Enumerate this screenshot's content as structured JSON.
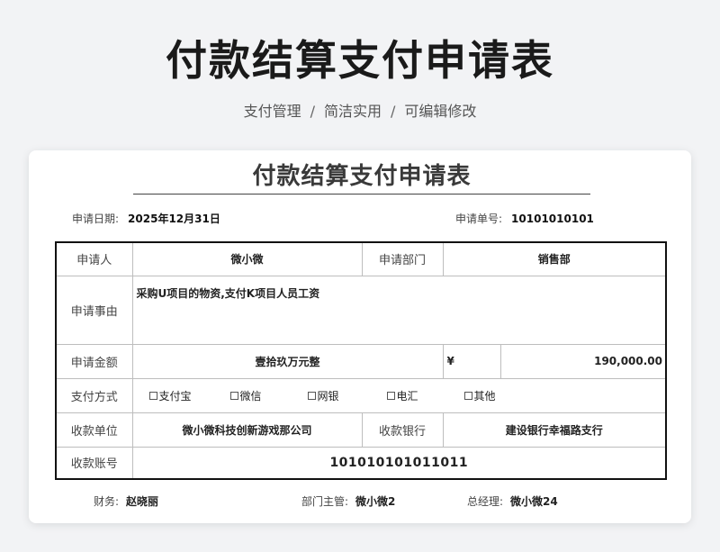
{
  "header": {
    "title": "付款结算支付申请表",
    "subtitle_parts": [
      "支付管理",
      "简洁实用",
      "可编辑修改"
    ],
    "separator": "/"
  },
  "form": {
    "title": "付款结算支付申请表",
    "date_label": "申请日期:",
    "date_value": "2025年12月31日",
    "no_label": "申请单号:",
    "no_value": "10101010101",
    "applicant_label": "申请人",
    "applicant_value": "微小微",
    "dept_label": "申请部门",
    "dept_value": "销售部",
    "reason_label": "申请事由",
    "reason_value": "采购U项目的物资,支付K项目人员工资",
    "amount_label": "申请金额",
    "amount_words": "壹拾玖万元整",
    "currency_symbol": "¥",
    "amount_value": "190,000.00",
    "method_label": "支付方式",
    "methods": [
      "支付宝",
      "微信",
      "网银",
      "电汇",
      "其他"
    ],
    "payee_label": "收款单位",
    "payee_value": "微小微科技创新游戏那公司",
    "bank_label": "收款银行",
    "bank_value": "建设银行幸福路支行",
    "account_label": "收款账号",
    "account_value": "101010101011011"
  },
  "footer": {
    "finance_label": "财务:",
    "finance_value": "赵晓丽",
    "manager_label": "部门主管:",
    "manager_value": "微小微2",
    "gm_label": "总经理:",
    "gm_value": "微小微24"
  }
}
